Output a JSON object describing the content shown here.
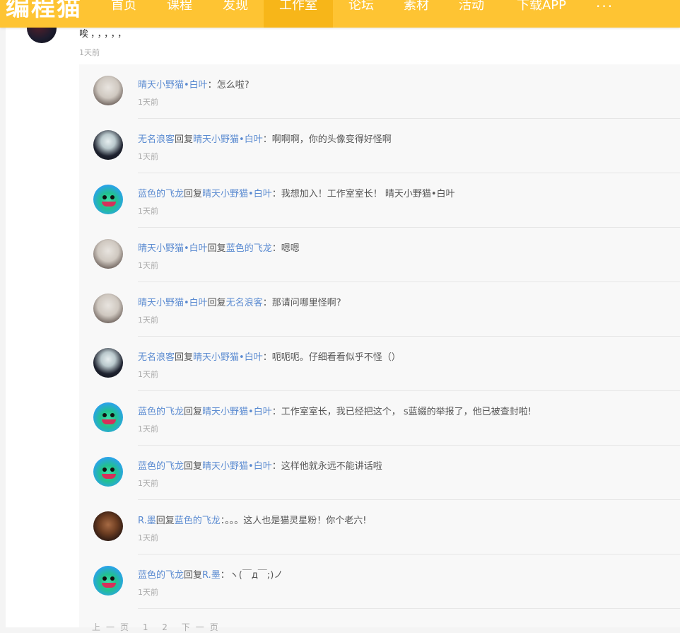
{
  "nav": {
    "logo": "编程猫",
    "items": [
      {
        "label": "首页"
      },
      {
        "label": "课程"
      },
      {
        "label": "发现"
      },
      {
        "label": "工作室",
        "active": true
      },
      {
        "label": "论坛"
      },
      {
        "label": "素材"
      },
      {
        "label": "活动"
      },
      {
        "label": "下载APP"
      }
    ],
    "more": "···"
  },
  "top_comment": {
    "text": "唉，，，，，",
    "time": "1天前"
  },
  "replies": [
    {
      "author": "晴天小野猫•白叶",
      "reply_word": "",
      "target": "",
      "sep": "：",
      "text": "怎么啦?",
      "time": "1天前",
      "avatar": "cat-girl"
    },
    {
      "author": "无名浪客",
      "reply_word": "回复",
      "target": "晴天小野猫•白叶",
      "sep": "：",
      "text": "啊啊啊，你的头像变得好怪啊",
      "time": "1天前",
      "avatar": "dark-girl"
    },
    {
      "author": "蓝色的飞龙",
      "reply_word": "回复",
      "target": "晴天小野猫•白叶",
      "sep": "：",
      "text": "我想加入！工作室室长！ 晴天小野猫•白叶",
      "time": "1天前",
      "avatar": "dragon"
    },
    {
      "author": "晴天小野猫•白叶",
      "reply_word": "回复",
      "target": "蓝色的飞龙",
      "sep": "：",
      "text": "嗯嗯",
      "time": "1天前",
      "avatar": "cat-girl"
    },
    {
      "author": "晴天小野猫•白叶",
      "reply_word": "回复",
      "target": "无名浪客",
      "sep": "：",
      "text": "那请问哪里怪啊?",
      "time": "1天前",
      "avatar": "cat-girl"
    },
    {
      "author": "无名浪客",
      "reply_word": "回复",
      "target": "晴天小野猫•白叶",
      "sep": "：",
      "text": "呃呃呃。仔细看看似乎不怪（）",
      "time": "1天前",
      "avatar": "dark-girl"
    },
    {
      "author": "蓝色的飞龙",
      "reply_word": "回复",
      "target": "晴天小野猫•白叶",
      "sep": "：",
      "text": "工作室室长，我已经把这个， s蓝綴的举报了，他已被查封啦!",
      "time": "1天前",
      "avatar": "dragon"
    },
    {
      "author": "蓝色的飞龙",
      "reply_word": "回复",
      "target": "晴天小野猫•白叶",
      "sep": "：",
      "text": "这样他就永远不能讲话啦",
      "time": "1天前",
      "avatar": "dragon"
    },
    {
      "author": "R.墨",
      "reply_word": "回复",
      "target": "蓝色的飞龙",
      "sep": "：",
      "text": "。。。这人也是猫灵星粉！你个老六!",
      "time": "1天前",
      "avatar": "r-mo"
    },
    {
      "author": "蓝色的飞龙",
      "reply_word": "回复",
      "target": "R.墨",
      "sep": "：",
      "text": "ヽ(￣д￣;)ノ",
      "time": "1天前",
      "avatar": "dragon"
    }
  ],
  "bottom_hint": "上一页 1 2 下一页"
}
